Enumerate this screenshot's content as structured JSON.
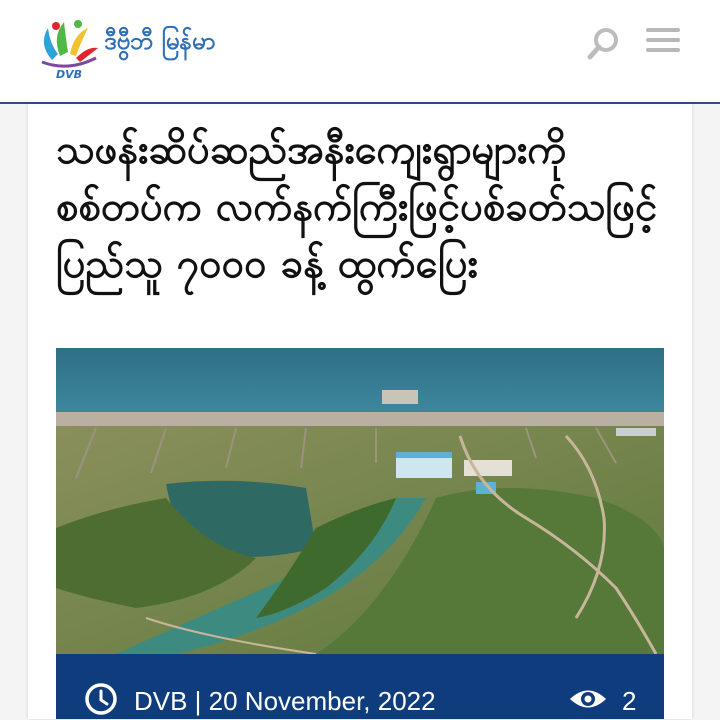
{
  "header": {
    "logo_text": "ဒီဗွီဘီ မြန်မာ",
    "logo_badge": "DVB"
  },
  "icons": {
    "search": "search-icon",
    "menu": "menu-icon",
    "clock": "clock-icon",
    "eye": "eye-icon"
  },
  "article": {
    "title": "သဖန်းဆိပ်ဆည်အနီးကျေးရွာများကို စစ်တပ်က လက်နက်ကြီးဖြင့်ပစ်ခတ်သဖြင့် ပြည်သူ ၇၀၀၀ ခန့် ထွက်ပြေး",
    "source": "DVB",
    "date": "20 November, 2022",
    "byline": "DVB | 20 November, 2022",
    "views": "2"
  },
  "colors": {
    "header_border": "#2c4f8a",
    "meta_bar": "#0f3c7c",
    "logo_text": "#2e6fb8"
  }
}
